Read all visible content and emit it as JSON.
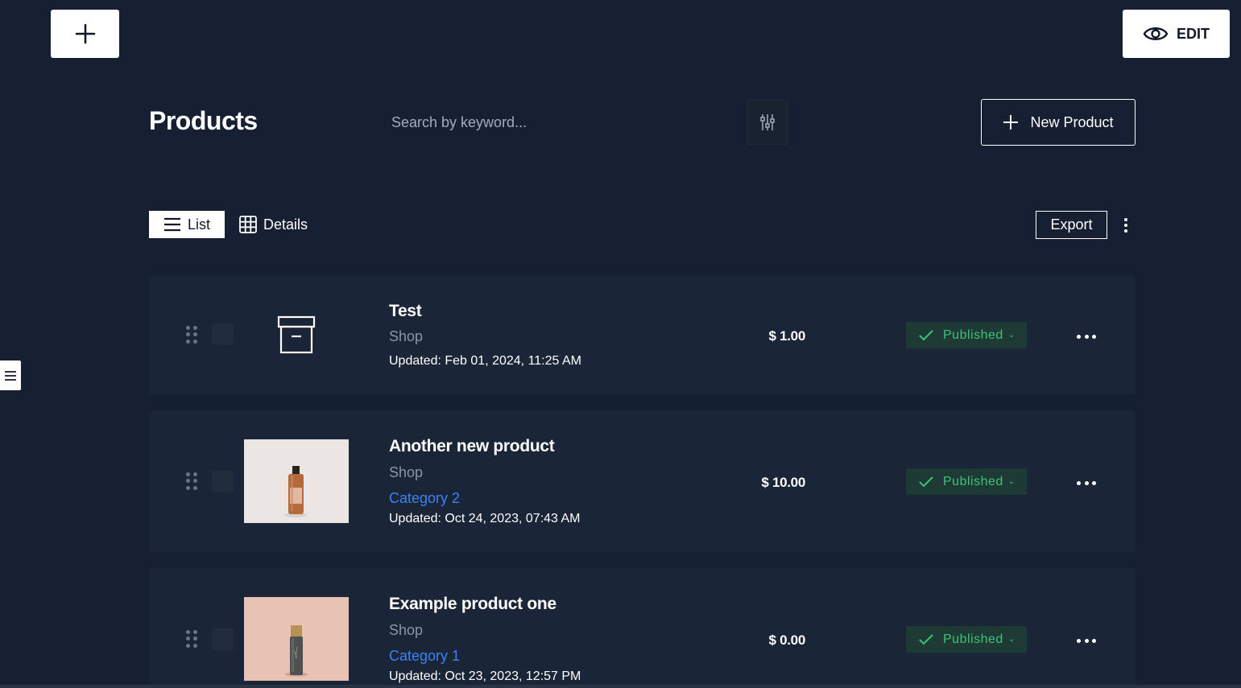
{
  "top_bar": {
    "add_icon": "plus-icon",
    "edit_label": "EDIT",
    "edit_icon": "eye-icon"
  },
  "header": {
    "title": "Products",
    "search_placeholder": "Search by keyword...",
    "filter_icon": "sliders-icon",
    "new_product_label": "New Product"
  },
  "toolbar": {
    "list_label": "List",
    "details_label": "Details",
    "export_label": "Export"
  },
  "products": [
    {
      "name": "Test",
      "shop": "Shop",
      "category": "",
      "updated": "Updated: Feb 01, 2024, 11:25 AM",
      "price": "$ 1.00",
      "status": "Published",
      "image": "archive-box-icon"
    },
    {
      "name": "Another new product",
      "shop": "Shop",
      "category": "Category 2",
      "updated": "Updated: Oct 24, 2023, 07:43 AM",
      "price": "$ 10.00",
      "status": "Published",
      "image": "amber-bottle-photo"
    },
    {
      "name": "Example product one",
      "shop": "Shop",
      "category": "Category 1",
      "updated": "Updated: Oct 23, 2023, 12:57 PM",
      "price": "$ 0.00",
      "status": "Published",
      "image": "dark-serum-bottle-photo"
    }
  ],
  "colors": {
    "background": "#172032",
    "card": "#1b2538",
    "published_bg": "#1d3a35",
    "published_text": "#3ec27b",
    "category_link": "#3b82f6"
  }
}
